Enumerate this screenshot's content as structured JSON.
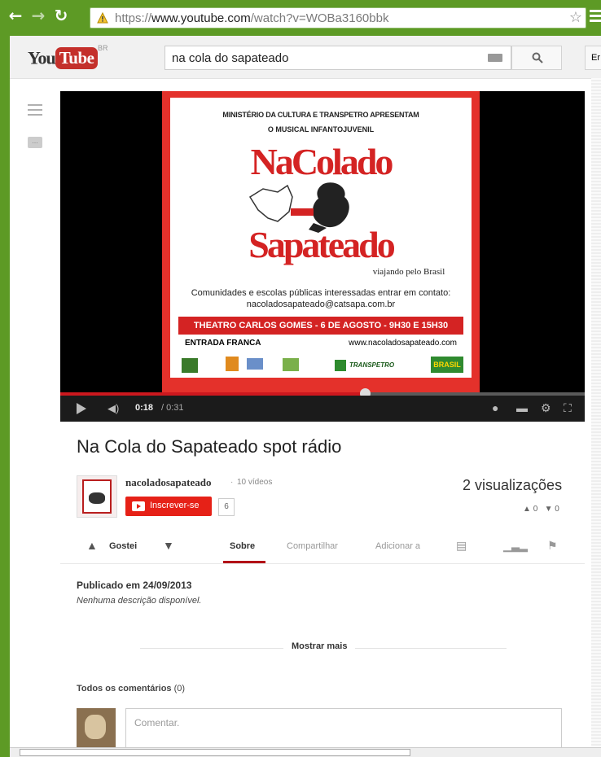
{
  "browser": {
    "url_scheme": "https://",
    "url_host": "www.youtube.com",
    "url_path": "/watch?v=WOBa3160bbk",
    "back_icon": "back-arrow-icon",
    "forward_icon": "forward-arrow-icon",
    "reload_icon": "reload-icon"
  },
  "header": {
    "logo_you": "You",
    "logo_tube": "Tube",
    "logo_region": "BR",
    "search_query": "na cola do sapateado",
    "upload_label": "Er"
  },
  "player": {
    "poster": {
      "line1": "MINISTÉRIO DA CULTURA E TRANSPETRO APRESENTAM",
      "line2": "O MUSICAL INFANTOJUVENIL",
      "title_top": "NaColado",
      "title_bottom": "Sapateado",
      "subtitle": "viajando pelo Brasil",
      "contact_line": "Comunidades e escolas públicas interessadas entrar em contato:",
      "contact_email": "nacoladosapateado@catsapa.com.br",
      "banner": "THEATRO CARLOS GOMES - 6 DE AGOSTO - 9H30 E 15H30",
      "entry": "ENTRADA FRANCA",
      "website": "www.nacoladosapateado.com",
      "sponsor_transpetro": "TRANSPETRO",
      "sponsor_brasil": "BRASIL"
    },
    "time_current": "0:18",
    "time_total": "/ 0:31",
    "progress": 0.58,
    "accent": "#cc181e"
  },
  "video": {
    "title": "Na Cola do Sapateado spot rádio",
    "channel_name": "nacoladosapateado",
    "channel_videos": "10 vídeos",
    "subscribe_label": "Inscrever-se",
    "subscriber_count": "6",
    "views": "2 visualizações",
    "likes": "0",
    "dislikes": "0"
  },
  "actions": {
    "like_label": "Gostei",
    "about": "Sobre",
    "share": "Compartilhar",
    "add_to": "Adicionar a"
  },
  "description": {
    "published": "Publicado em 24/09/2013",
    "text": "Nenhuma descrição disponível.",
    "show_more": "Mostrar mais"
  },
  "comments": {
    "heading": "Todos os comentários",
    "count": "(0)",
    "placeholder": "Comentar."
  }
}
